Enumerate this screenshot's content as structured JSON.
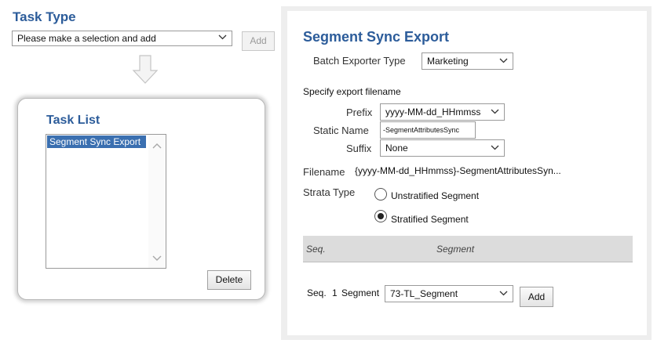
{
  "task_type": {
    "title": "Task Type",
    "select_value": "Please make a selection and add",
    "add_label": "Add"
  },
  "task_list": {
    "title": "Task List",
    "items": [
      "Segment Sync Export"
    ],
    "delete_label": "Delete"
  },
  "export": {
    "title": "Segment Sync Export",
    "batch_exporter_label": "Batch Exporter Type",
    "batch_exporter_value": "Marketing",
    "specify_label": "Specify export filename",
    "prefix_label": "Prefix",
    "prefix_value": "yyyy-MM-dd_HHmmss",
    "static_name_label": "Static Name",
    "static_name_value": "-SegmentAttributesSync",
    "suffix_label": "Suffix",
    "suffix_value": "None",
    "filename_label": "Filename",
    "filename_value": "{yyyy-MM-dd_HHmmss}-SegmentAttributesSyn...",
    "strata_label": "Strata Type",
    "strata_options": [
      "Unstratified Segment",
      "Stratified Segment"
    ],
    "strata_selected": "Stratified Segment",
    "table_headers": [
      "Seq.",
      "Segment"
    ],
    "seq_label": "Seq.",
    "seq_value": "1",
    "segment_label": "Segment",
    "segment_value": "73-TL_Segment",
    "add_label": "Add"
  },
  "colors": {
    "heading": "#2c5c9a",
    "selection": "#3a6fb0",
    "panel_bg": "#eeeeee"
  }
}
